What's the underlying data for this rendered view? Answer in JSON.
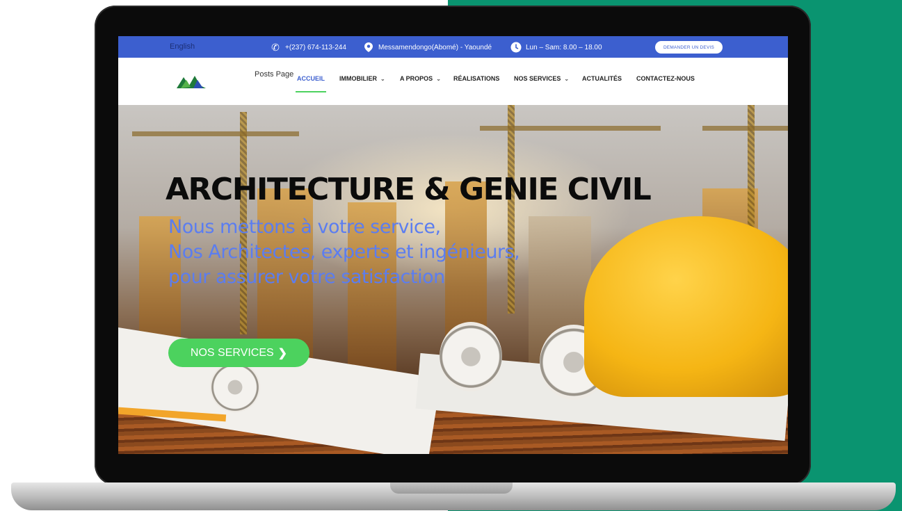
{
  "topbar": {
    "language": "English",
    "phone": "+(237) 674-113-244",
    "location": "Messamendongo(Abomé) - Yaoundé",
    "hours": "Lun – Sam: 8.00 – 18.00",
    "quote_button": "DEMANDER UN DEVIS",
    "icons": [
      "phone-icon",
      "map-pin-icon",
      "clock-icon"
    ],
    "color": "#3c5fcf"
  },
  "navbar": {
    "posts_page": "Posts Page",
    "items": [
      {
        "label": "ACCUEIL",
        "active": true
      },
      {
        "label": "IMMOBILIER",
        "dropdown": true
      },
      {
        "label": "A PROPOS",
        "dropdown": true
      },
      {
        "label": "RÉALISATIONS"
      },
      {
        "label": "NOS SERVICES",
        "dropdown": true
      },
      {
        "label": "ACTUALITÉS"
      },
      {
        "label": "CONTACTEZ-NOUS"
      }
    ],
    "active_underline_color": "#4cd25e"
  },
  "hero": {
    "title": "ARCHITECTURE & GENIE CIVIL",
    "subtitle_lines": [
      "Nous mettons à votre service,",
      "Nos Architectes, experts et ingénieurs,",
      "pour assurer votre satisfaction"
    ],
    "cta": "NOS SERVICES",
    "cta_icon": "chevron-right-icon",
    "subtitle_color": "#5b7df0",
    "cta_color": "#4cd25e"
  },
  "backdrop_color": "#0a9470"
}
